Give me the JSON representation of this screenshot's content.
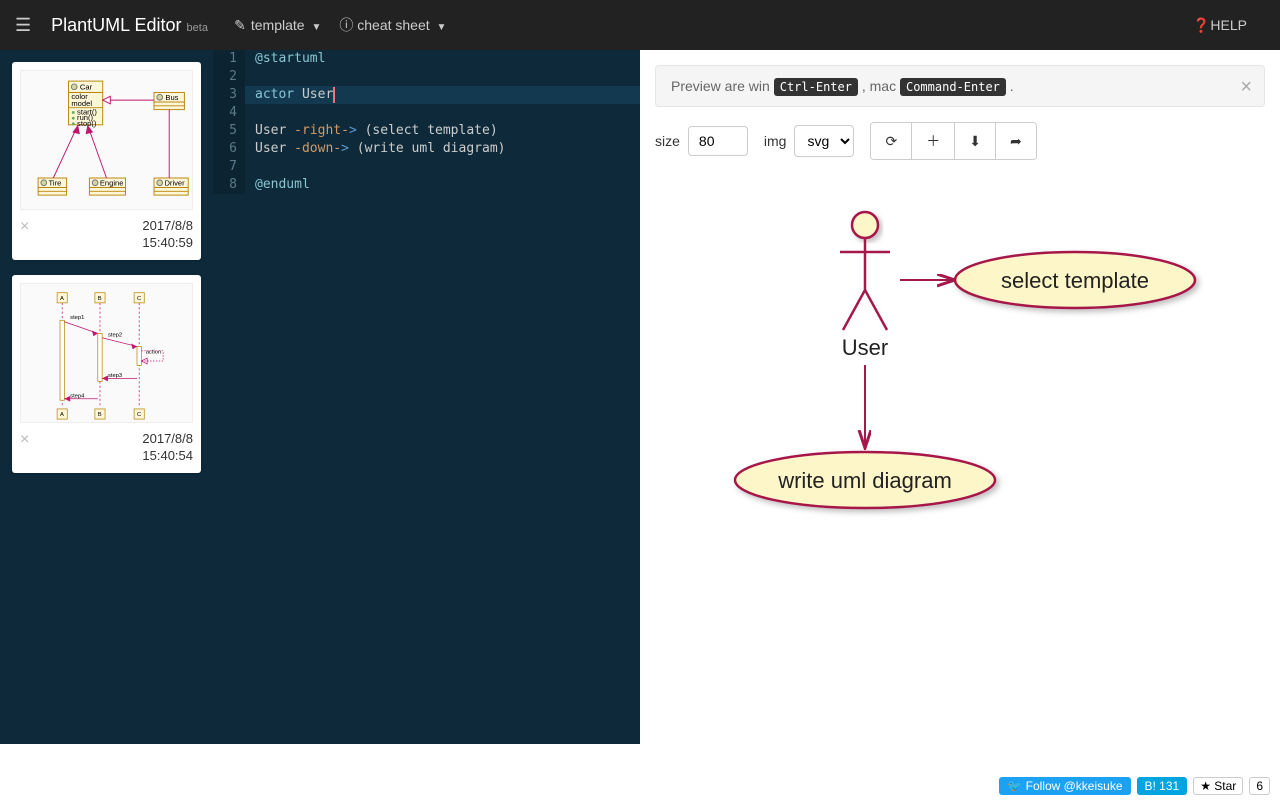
{
  "navbar": {
    "brand": "PlantUML Editor",
    "beta": "beta",
    "template_label": "template",
    "cheatsheet_label": "cheat sheet",
    "help_label": "HELP"
  },
  "sidebar": {
    "cards": [
      {
        "date": "2017/8/8",
        "time": "15:40:59"
      },
      {
        "date": "2017/8/8",
        "time": "15:40:54"
      }
    ]
  },
  "editor": {
    "lines": [
      "@startuml",
      "",
      "actor User",
      "",
      "User -right-> (select template)",
      "User -down-> (write uml diagram)",
      "",
      "@enduml"
    ]
  },
  "preview": {
    "alert_prefix": "Preview are win",
    "alert_kbd1": "Ctrl-Enter",
    "alert_mid": ", mac",
    "alert_kbd2": "Command-Enter",
    "alert_suffix": ".",
    "size_label": "size",
    "size_value": "80",
    "img_label": "img",
    "img_value": "svg",
    "diagram": {
      "actor_label": "User",
      "usecase1": "select template",
      "usecase2": "write uml diagram"
    }
  },
  "footer": {
    "twitter": "Follow @kkeisuke",
    "b_badge": "B! 131",
    "star_label": "Star",
    "star_count": "6"
  },
  "thumb1": {
    "car": "Car",
    "bus": "Bus",
    "tire": "Tire",
    "engine": "Engine",
    "driver": "Driver",
    "color": "color",
    "model": "model",
    "start": "start()",
    "run": "run()",
    "stop": "stop()"
  },
  "thumb2": {
    "a": "A",
    "b": "B",
    "c": "C",
    "s1": "step1",
    "s2": "step2",
    "s3": "step3",
    "s4": "step4",
    "action": "action"
  }
}
